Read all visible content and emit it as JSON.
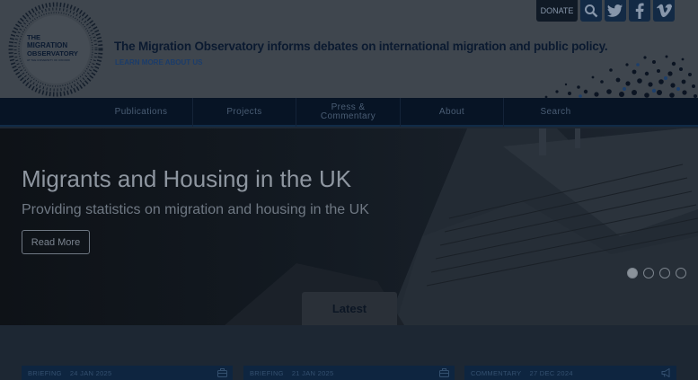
{
  "header": {
    "logo_text": [
      "THE",
      "MIGRATION",
      "OBSERVATORY",
      "AT THE UNIVERSITY OF OXFORD"
    ],
    "tagline": "The Migration Observatory informs debates on international migration and public policy.",
    "learn_more": "LEARN MORE ABOUT US",
    "donate": "DONATE",
    "icons": [
      "search-icon",
      "twitter-icon",
      "facebook-icon",
      "vimeo-icon"
    ]
  },
  "nav": {
    "items": [
      {
        "label": "Publications"
      },
      {
        "label": "Projects"
      },
      {
        "label": "Press & Commentary"
      },
      {
        "label": "About"
      },
      {
        "label": "Search"
      }
    ]
  },
  "hero": {
    "title": "Migrants and Housing in the UK",
    "subtitle": "Providing statistics on migration and housing in the UK",
    "cta": "Read More",
    "slides": 4,
    "active_slide": 1
  },
  "latest_tab": "Latest",
  "cards": [
    {
      "type": "BRIEFING",
      "date": "24 JAN 2025",
      "icon": "briefcase-icon"
    },
    {
      "type": "BRIEFING",
      "date": "21 JAN 2025",
      "icon": "briefcase-icon"
    },
    {
      "type": "COMMENTARY",
      "date": "27 DEC 2024",
      "icon": "megaphone-icon"
    }
  ],
  "colors": {
    "header_bg": "#3f464e",
    "nav_bg": "#071425",
    "accent": "#132a45"
  }
}
